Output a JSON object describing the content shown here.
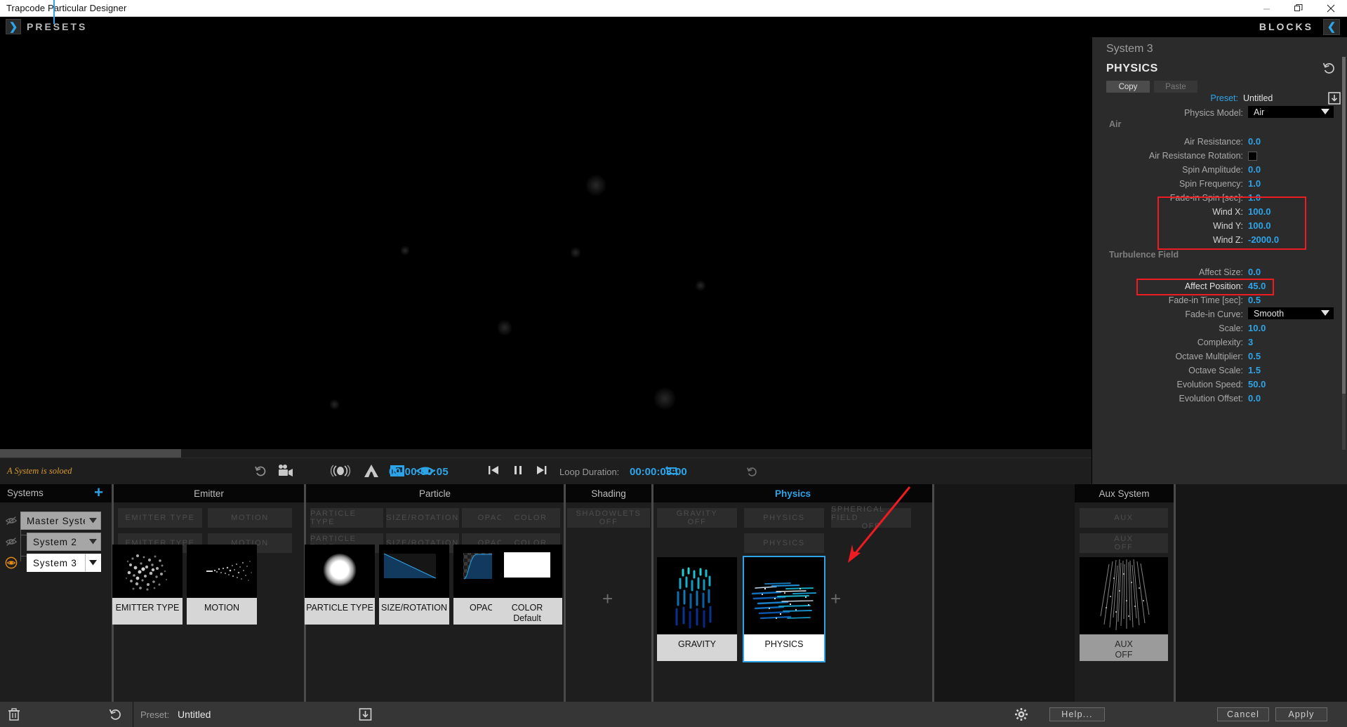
{
  "window": {
    "title": "Trapcode Particular Designer",
    "minimize": "minimize-icon",
    "maximize": "maximize-icon",
    "close": "close-icon"
  },
  "topbar": {
    "presets_label": "PRESETS",
    "presets_toggle_icon": "chevron-right-icon",
    "blocks_label": "BLOCKS",
    "blocks_toggle_icon": "chevron-left-icon"
  },
  "viewport": {
    "solo_warning": "A System is soloed",
    "toolbar": [
      {
        "name": "undo-icon",
        "glyph": "↺"
      },
      {
        "name": "camera-icon",
        "glyph": "■"
      },
      {
        "name": "motion-blur-icon",
        "glyph": "◉"
      },
      {
        "name": "depth-of-field-icon",
        "glyph": "A"
      },
      {
        "name": "fit-view-icon",
        "glyph": "◱"
      },
      {
        "name": "preview-eye-icon",
        "glyph": "◉"
      }
    ],
    "transport": {
      "first_frame_icon": "skip-back-icon",
      "pause_icon": "pause-icon",
      "next_frame_icon": "skip-forward-icon",
      "timecode": "00:00:00:05",
      "loop_icon": "loop-icon",
      "loop_label": "Loop Duration:",
      "loop_duration": "00:00:03:00",
      "loop_reset_icon": "reset-icon"
    }
  },
  "panel": {
    "system_label": "System 3",
    "title": "PHYSICS",
    "reset_icon": "reset-icon",
    "copy_label": "Copy",
    "paste_label": "Paste",
    "preset_key": "Preset:",
    "preset_value": "Untitled",
    "preset_save_icon": "save-preset-icon",
    "physics_model_key": "Physics Model:",
    "physics_model_value": "Air",
    "groups": [
      {
        "name": "Air",
        "params": [
          {
            "key": "Air Resistance:",
            "value": "0.0",
            "type": "number"
          },
          {
            "key": "Air Resistance Rotation:",
            "value": "",
            "type": "checkbox"
          },
          {
            "key": "Spin Amplitude:",
            "value": "0.0",
            "type": "number"
          },
          {
            "key": "Spin Frequency:",
            "value": "1.0",
            "type": "number"
          },
          {
            "key": "Fade-in Spin [sec]:",
            "value": "1.0",
            "type": "number"
          },
          {
            "key": "Wind X:",
            "value": "100.0",
            "type": "number",
            "highlighted": true
          },
          {
            "key": "Wind Y:",
            "value": "100.0",
            "type": "number",
            "highlighted": true
          },
          {
            "key": "Wind Z:",
            "value": "-2000.0",
            "type": "number",
            "highlighted": true
          }
        ]
      },
      {
        "name": "Turbulence Field",
        "params": [
          {
            "key": "Affect Size:",
            "value": "0.0",
            "type": "number"
          },
          {
            "key": "Affect Position:",
            "value": "45.0",
            "type": "number",
            "highlighted": true
          },
          {
            "key": "Fade-in Time [sec]:",
            "value": "0.5",
            "type": "number"
          },
          {
            "key": "Fade-in Curve:",
            "value": "Smooth",
            "type": "dropdown"
          },
          {
            "key": "Scale:",
            "value": "10.0",
            "type": "number"
          },
          {
            "key": "Complexity:",
            "value": "3",
            "type": "number"
          },
          {
            "key": "Octave Multiplier:",
            "value": "0.5",
            "type": "number"
          },
          {
            "key": "Octave Scale:",
            "value": "1.5",
            "type": "number"
          },
          {
            "key": "Evolution Speed:",
            "value": "50.0",
            "type": "number"
          },
          {
            "key": "Evolution Offset:",
            "value": "0.0",
            "type": "number"
          }
        ]
      }
    ],
    "accent_color": "#2ea4e8",
    "highlight_color": "#ee1c22"
  },
  "systems": {
    "header": "Systems",
    "add_icon": "plus-icon",
    "rows": [
      {
        "label": "Master System",
        "visible": false,
        "selected": false
      },
      {
        "label": "System 2",
        "visible": false,
        "selected": false
      },
      {
        "label": "System 3",
        "visible": true,
        "selected": true
      }
    ]
  },
  "blocks": {
    "columns": [
      {
        "header": "Emitter",
        "ghosts": [
          [
            "EMITTER TYPE"
          ],
          [
            "MOTION"
          ],
          [
            "EMITTER TYPE"
          ],
          [
            "MOTION"
          ]
        ],
        "cards": [
          {
            "label": "EMITTER TYPE",
            "sub": "",
            "thumb": "emitter-cloud-thumb",
            "state": "normal"
          },
          {
            "label": "MOTION",
            "sub": "",
            "thumb": "motion-cone-thumb",
            "state": "normal"
          }
        ]
      },
      {
        "header": "Particle",
        "ghosts": [
          [
            "PARTICLE TYPE"
          ],
          [
            "SIZE/ROTATION"
          ],
          [
            "OPACITY"
          ],
          [
            "COLOR"
          ],
          [
            "PARTICLE TYPE"
          ],
          [
            "SIZE/ROTATION"
          ],
          [
            "OPACITY"
          ],
          [
            "COLOR"
          ]
        ],
        "cards": [
          {
            "label": "PARTICLE TYPE",
            "sub": "",
            "thumb": "sphere-thumb",
            "state": "normal"
          },
          {
            "label": "SIZE/ROTATION",
            "sub": "",
            "thumb": "size-ramp-thumb",
            "state": "normal"
          },
          {
            "label": "OPACITY",
            "sub": "",
            "thumb": "opacity-curve-thumb",
            "state": "normal"
          },
          {
            "label": "COLOR",
            "sub": "Default",
            "thumb": "white-swatch-thumb",
            "state": "normal"
          }
        ]
      },
      {
        "header": "Shading",
        "ghosts": [
          [
            "SHADOWLETS",
            "OFF"
          ]
        ],
        "cards": [],
        "add_icon": "plus-icon"
      },
      {
        "header": "Physics",
        "active": true,
        "ghosts": [
          [
            "GRAVITY",
            "OFF"
          ],
          [
            "PHYSICS"
          ],
          [
            "SPHERICAL FIELD",
            "OFF"
          ],
          [
            "PHYSICS"
          ]
        ],
        "cards": [
          {
            "label": "GRAVITY",
            "sub": "",
            "thumb": "gravity-streaks-thumb",
            "state": "normal"
          },
          {
            "label": "PHYSICS",
            "sub": "",
            "thumb": "physics-wind-thumb",
            "state": "selected"
          }
        ],
        "add_icon": "plus-icon"
      },
      {
        "header": "Aux System",
        "ghosts": [
          [
            "AUX"
          ],
          [
            "AUX",
            "OFF"
          ]
        ],
        "cards": [
          {
            "label": "AUX",
            "sub": "OFF",
            "thumb": "aux-rain-thumb",
            "state": "muted"
          }
        ]
      }
    ]
  },
  "statusbar": {
    "delete_icon": "trash-icon",
    "reset_icon": "reset-icon",
    "preset_key": "Preset:",
    "preset_value": "Untitled",
    "preset_save_icon": "save-preset-icon",
    "settings_icon": "gear-icon",
    "help_label": "Help...",
    "cancel_label": "Cancel",
    "apply_label": "Apply"
  }
}
